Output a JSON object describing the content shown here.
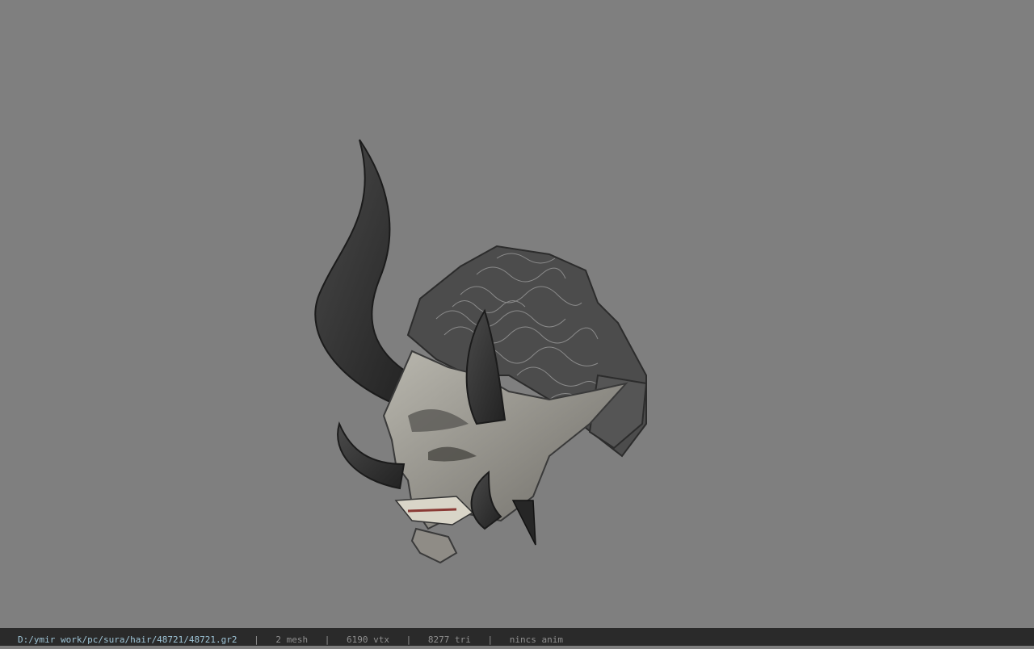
{
  "viewport": {
    "background": "#7f7f7f",
    "model_icon": "demon-head-mask-model"
  },
  "status": {
    "file_path": "D:/ymir work/pc/sura/hair/48721/48721.gr2",
    "separator": "|",
    "mesh": "2 mesh",
    "vtx": "6190 vtx",
    "tri": "8277 tri",
    "anim": "nincs anim"
  }
}
